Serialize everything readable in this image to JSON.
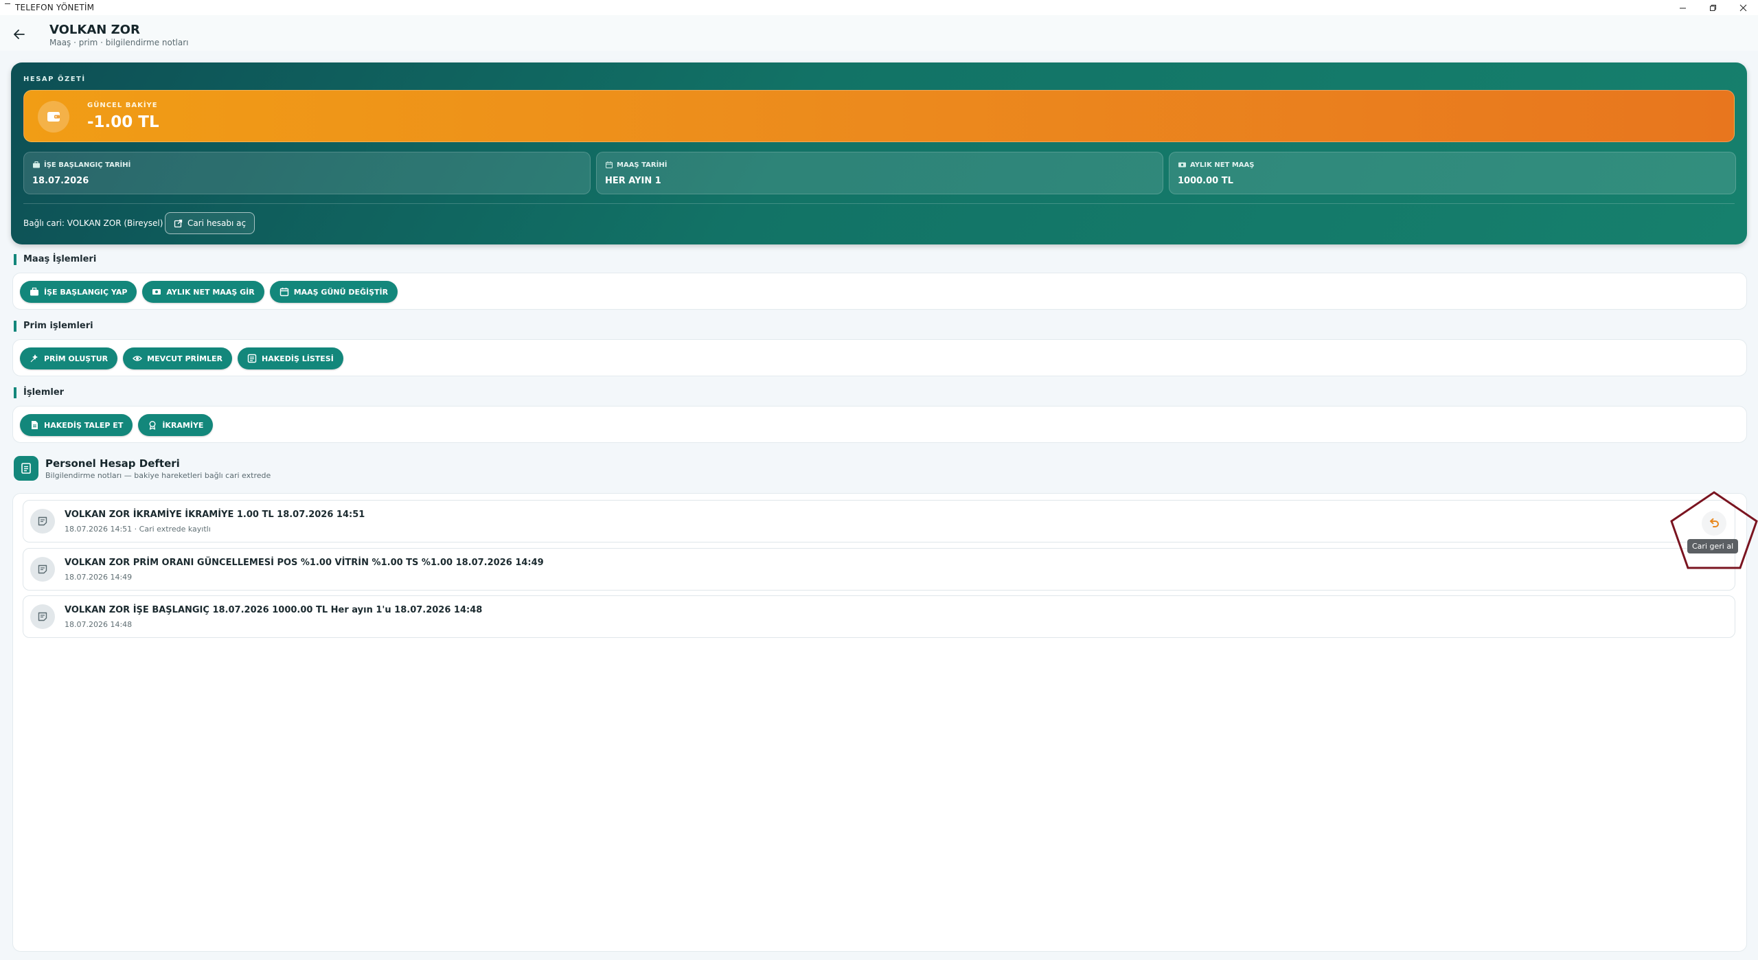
{
  "window": {
    "title": "TELEFON YÖNETİM"
  },
  "header": {
    "title": "VOLKAN ZOR",
    "subtitle": "Maaş · prim · bilgilendirme notları"
  },
  "summary": {
    "section_label": "HESAP ÖZETİ",
    "balance_label": "GÜNCEL BAKİYE",
    "balance_value": "-1.00 TL",
    "start_date_label": "İŞE BAŞLANGIÇ TARİHİ",
    "start_date_value": "18.07.2026",
    "salary_date_label": "MAAŞ TARİHİ",
    "salary_date_value": "HER AYIN 1",
    "net_salary_label": "AYLIK NET MAAŞ",
    "net_salary_value": "1000.00 TL",
    "linked_account": "Bağlı cari: VOLKAN ZOR (Bireysel)",
    "open_account_button": "Cari hesabı aç"
  },
  "salary_ops": {
    "title": "Maaş İşlemleri",
    "buttons": [
      "İŞE BAŞLANGIÇ YAP",
      "AYLIK NET MAAŞ GİR",
      "MAAŞ GÜNÜ DEĞİŞTİR"
    ]
  },
  "bonus_ops": {
    "title": "Prim işlemleri",
    "buttons": [
      "PRİM OLUŞTUR",
      "MEVCUT PRİMLER",
      "HAKEDİŞ LİSTESİ"
    ]
  },
  "ops": {
    "title": "İşlemler",
    "buttons": [
      "HAKEDİŞ TALEP ET",
      "İKRAMİYE"
    ]
  },
  "ledger": {
    "title": "Personel Hesap Defteri",
    "subtitle": "Bilgilendirme notları — bakiye hareketleri bağlı cari extrede",
    "entries": [
      {
        "title": "VOLKAN ZOR İKRAMİYE İKRAMİYE 1.00 TL 18.07.2026 14:51",
        "meta": "18.07.2026 14:51 · Cari extrede kayıtlı"
      },
      {
        "title": "VOLKAN ZOR PRİM ORANI GÜNCELLEMESİ POS %1.00 VİTRİN %1.00 TS %1.00 18.07.2026 14:49",
        "meta": "18.07.2026 14:49"
      },
      {
        "title": "VOLKAN ZOR İŞE BAŞLANGIÇ 18.07.2026 1000.00 TL Her ayın 1'u 18.07.2026 14:48",
        "meta": "18.07.2026 14:48"
      }
    ],
    "undo_tooltip": "Cari geri al"
  },
  "colors": {
    "primary": "#13877b",
    "summary_dark": "#0d4f55",
    "balance_orange": "#ec8a1d",
    "highlight": "#7a1420"
  },
  "icons": {
    "back": "arrow-left-icon",
    "wallet": "wallet-icon",
    "undo": "undo-icon",
    "note": "note-icon",
    "ledger": "ledger-book-icon"
  }
}
